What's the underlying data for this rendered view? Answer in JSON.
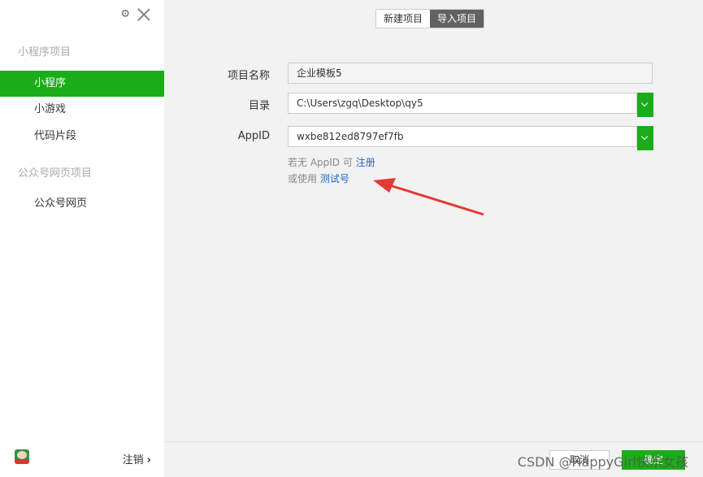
{
  "sidebar": {
    "sections": [
      {
        "title": "小程序项目"
      },
      {
        "title": "公众号网页项目"
      }
    ],
    "items": [
      {
        "label": "小程序",
        "active": true
      },
      {
        "label": "小游戏"
      },
      {
        "label": "代码片段"
      },
      {
        "label": "公众号网页"
      }
    ],
    "logout_label": "注销",
    "icons": {
      "settings": "gear-icon",
      "close": "close-icon"
    }
  },
  "tabs": [
    {
      "label": "新建项目"
    },
    {
      "label": "导入项目",
      "active": true
    }
  ],
  "form": {
    "name_label": "项目名称",
    "name_value": "企业模板5",
    "dir_label": "目录",
    "dir_value": "C:\\Users\\zgq\\Desktop\\qy5",
    "appid_label": "AppID",
    "appid_value": "wxbe812ed8797ef7fb",
    "hint1_prefix": "若无 AppID 可",
    "hint1_link": "注册",
    "hint2_prefix": "或使用",
    "hint2_link": "测试号"
  },
  "footer": {
    "cancel_label": "取消",
    "confirm_label": "确定"
  },
  "watermark": "CSDN @HappyGirl快乐女孩",
  "colors": {
    "accent": "#1aad19",
    "link": "#2467c7",
    "arrow": "#e53935"
  }
}
